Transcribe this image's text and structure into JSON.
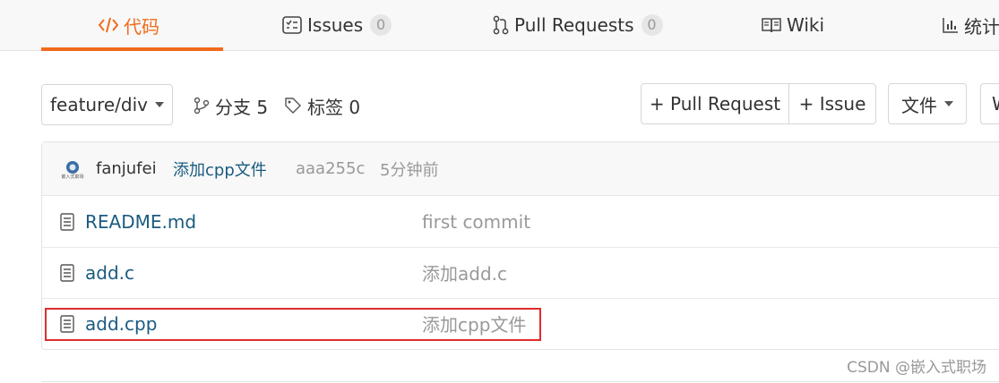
{
  "tabs": [
    {
      "label": "代码",
      "icon": "code-icon",
      "active": true
    },
    {
      "label": "Issues",
      "icon": "issues-icon",
      "count": "0"
    },
    {
      "label": "Pull Requests",
      "icon": "pull-request-icon",
      "count": "0"
    },
    {
      "label": "Wiki",
      "icon": "book-icon"
    },
    {
      "label": "统计",
      "icon": "bar-chart-icon"
    }
  ],
  "toolbar": {
    "branch_select": "feature/div",
    "branches_label": "分支 5",
    "tags_label": "标签 0",
    "new_pull_request": "+ Pull Request",
    "new_issue": "+ Issue",
    "file_menu": "文件",
    "cutoff_button": "W"
  },
  "commit": {
    "author": "fanjufei",
    "avatar_caption": "嵌入式职场",
    "message": "添加cpp文件",
    "hash": "aaa255c",
    "time": "5分钟前"
  },
  "files": [
    {
      "name": "README.md",
      "message": "first commit"
    },
    {
      "name": "add.c",
      "message": "添加add.c"
    },
    {
      "name": "add.cpp",
      "message": "添加cpp文件"
    }
  ],
  "watermark": "CSDN @嵌入式职场",
  "colors": {
    "accent": "#f26b1d",
    "link": "#1a5b80",
    "highlight": "#e02d2d"
  }
}
